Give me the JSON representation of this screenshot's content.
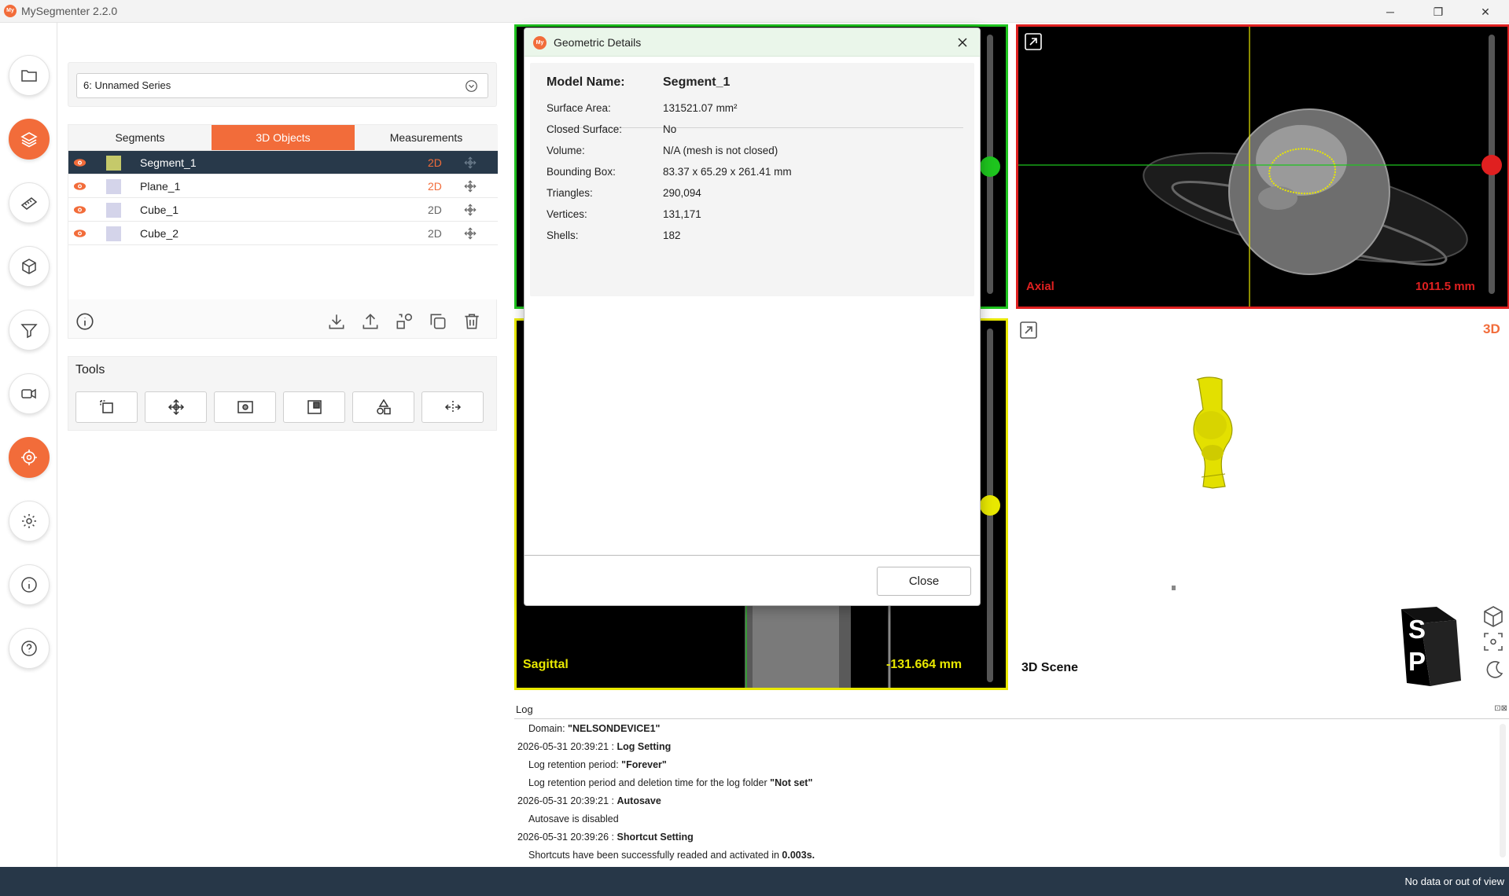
{
  "window": {
    "title": "MySegmenter 2.2.0",
    "icon_text": "My",
    "minimize": "─",
    "restore": "❐",
    "close": "✕"
  },
  "series": {
    "selected": "6: Unnamed Series"
  },
  "tabs": [
    {
      "label": "Segments",
      "active": false
    },
    {
      "label": "3D Objects",
      "active": true
    },
    {
      "label": "Measurements",
      "active": false
    }
  ],
  "objects": [
    {
      "name": "Segment_1",
      "mode": "2D",
      "color": "#c5c96a",
      "selected": true,
      "mode_color": "orange"
    },
    {
      "name": "Plane_1",
      "mode": "2D",
      "color": "#d4d4ea",
      "selected": false,
      "mode_color": "orange"
    },
    {
      "name": "Cube_1",
      "mode": "2D",
      "color": "#d4d4ea",
      "selected": false,
      "mode_color": "gray"
    },
    {
      "name": "Cube_2",
      "mode": "2D",
      "color": "#d4d4ea",
      "selected": false,
      "mode_color": "gray"
    }
  ],
  "tools": {
    "label": "Tools"
  },
  "viewports": {
    "axial": {
      "label": "Axial",
      "measure": "1011.5 mm"
    },
    "sagittal": {
      "label": "Sagittal",
      "measure": "-131.664 mm"
    },
    "scene3d": {
      "label": "3D Scene",
      "badge": "3D",
      "cube_top": "S",
      "cube_front": "P"
    }
  },
  "dialog": {
    "title": "Geometric Details",
    "model_name_key": "Model Name:",
    "model_name_value": "Segment_1",
    "rows": [
      {
        "key": "Surface Area:",
        "value": "131521.07 mm²"
      },
      {
        "key": "Closed Surface:",
        "value": "No"
      },
      {
        "key": "Volume:",
        "value": "N/A (mesh is not closed)"
      },
      {
        "key": "Bounding Box:",
        "value": "83.37 x 65.29 x 261.41 mm"
      },
      {
        "key": "Triangles:",
        "value": "290,094"
      },
      {
        "key": "Vertices:",
        "value": "131,171"
      },
      {
        "key": "Shells:",
        "value": "182"
      }
    ],
    "close_label": "Close"
  },
  "log": {
    "title": "Log",
    "lines": [
      {
        "indent": true,
        "pre": "Domain: ",
        "bold": "\"NELSONDEVICE1\"",
        "post": ""
      },
      {
        "indent": false,
        "pre": "2026-05-31 20:39:21 : ",
        "bold": "Log Setting",
        "post": ""
      },
      {
        "indent": true,
        "pre": "Log retention period: ",
        "bold": "\"Forever\"",
        "post": ""
      },
      {
        "indent": true,
        "pre": "Log retention period and deletion time for the log folder ",
        "bold": "\"Not set\"",
        "post": ""
      },
      {
        "indent": false,
        "pre": "2026-05-31 20:39:21 : ",
        "bold": "Autosave",
        "post": ""
      },
      {
        "indent": true,
        "pre": "Autosave is disabled",
        "bold": "",
        "post": ""
      },
      {
        "indent": false,
        "pre": "2026-05-31 20:39:26 : ",
        "bold": "Shortcut Setting",
        "post": ""
      },
      {
        "indent": true,
        "pre": "Shortcuts have been successfully readed and activated in ",
        "bold": "0.003s.",
        "post": ""
      }
    ]
  },
  "status": {
    "text": "No data or out of view"
  },
  "colors": {
    "accent": "#f26c3a",
    "statusbar": "#273748",
    "green": "#1ec41e",
    "red": "#e02020",
    "yellow": "#e8e800"
  },
  "icons": [
    "folder-icon",
    "layers-icon",
    "ruler-icon",
    "cube-icon",
    "filter-icon",
    "video-icon",
    "target-icon",
    "gear-icon",
    "info-icon",
    "help-icon"
  ]
}
